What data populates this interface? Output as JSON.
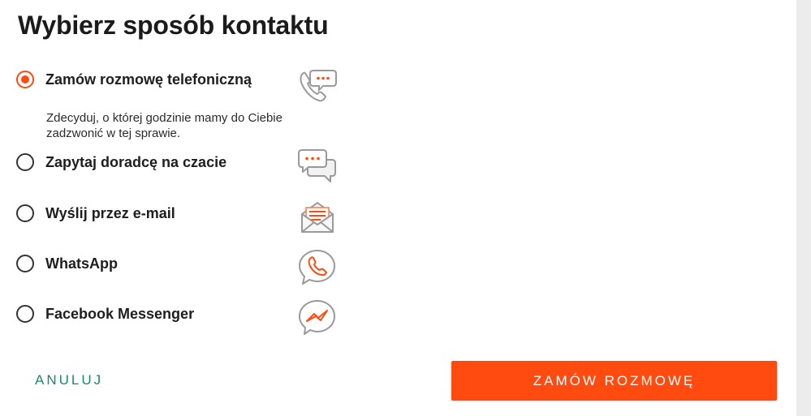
{
  "dialog": {
    "title": "Wybierz sposób kontaktu",
    "options": [
      {
        "label": "Zamów rozmowę telefoniczną",
        "selected": true,
        "description": "Zdecyduj, o której godzinie mamy do Ciebie zadzwonić w tej sprawie.",
        "icon": "phone-chat-icon"
      },
      {
        "label": "Zapytaj doradcę na czacie",
        "selected": false,
        "icon": "chat-bubbles-icon"
      },
      {
        "label": "Wyślij przez e-mail",
        "selected": false,
        "icon": "email-envelope-icon"
      },
      {
        "label": "WhatsApp",
        "selected": false,
        "icon": "whatsapp-icon"
      },
      {
        "label": "Facebook Messenger",
        "selected": false,
        "icon": "messenger-icon"
      }
    ],
    "actions": {
      "cancel_label": "ANULUJ",
      "submit_label": "ZAMÓW ROZMOWĘ"
    },
    "colors": {
      "accent": "#ff4b0f",
      "cancel_text": "#1c8a63",
      "icon_gray": "#9a9a9a"
    }
  }
}
